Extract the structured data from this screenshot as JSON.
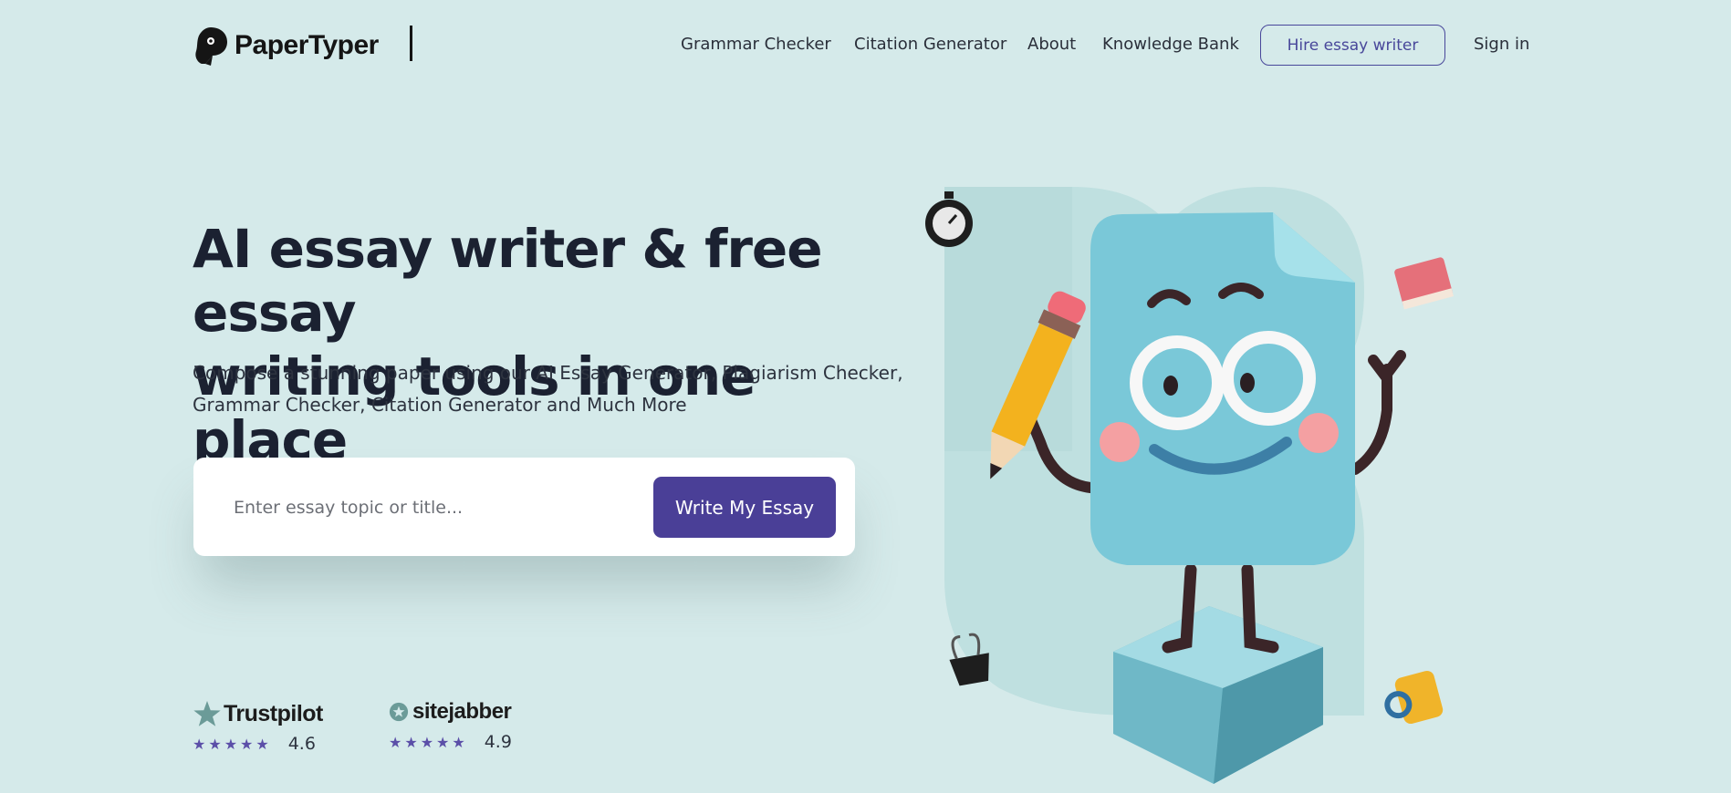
{
  "brand": {
    "name": "PaperTyper"
  },
  "nav": {
    "links": [
      "Grammar Checker",
      "Citation Generator",
      "About",
      "Knowledge Bank"
    ],
    "hire_label": "Hire essay writer",
    "signin_label": "Sign in"
  },
  "hero": {
    "title_line1": "AI essay writer & free essay",
    "title_line2": "writing tools in one place",
    "subtitle_line1": "Compose a stunning paper using our AI Essay Generator, Plagiarism Checker,",
    "subtitle_line2": "Grammar Checker, Citation Generator and Much More",
    "search": {
      "placeholder": "Enter essay topic or title...",
      "value": "",
      "button_label": "Write My Essay"
    }
  },
  "ratings": [
    {
      "name": "Trustpilot",
      "stars": "★★★★★",
      "score": "4.6",
      "icon": "star-icon"
    },
    {
      "name": "sitejabber",
      "stars": "★★★★★",
      "score": "4.9",
      "icon": "sitejabber-star-icon"
    }
  ],
  "colors": {
    "background": "#d5eaea",
    "accent": "#4a3f97",
    "outline_button": "#48479a",
    "star": "#5b4fa8",
    "illustration_blob": "#bfe0e0",
    "mascot_body": "#7ac8d8"
  }
}
